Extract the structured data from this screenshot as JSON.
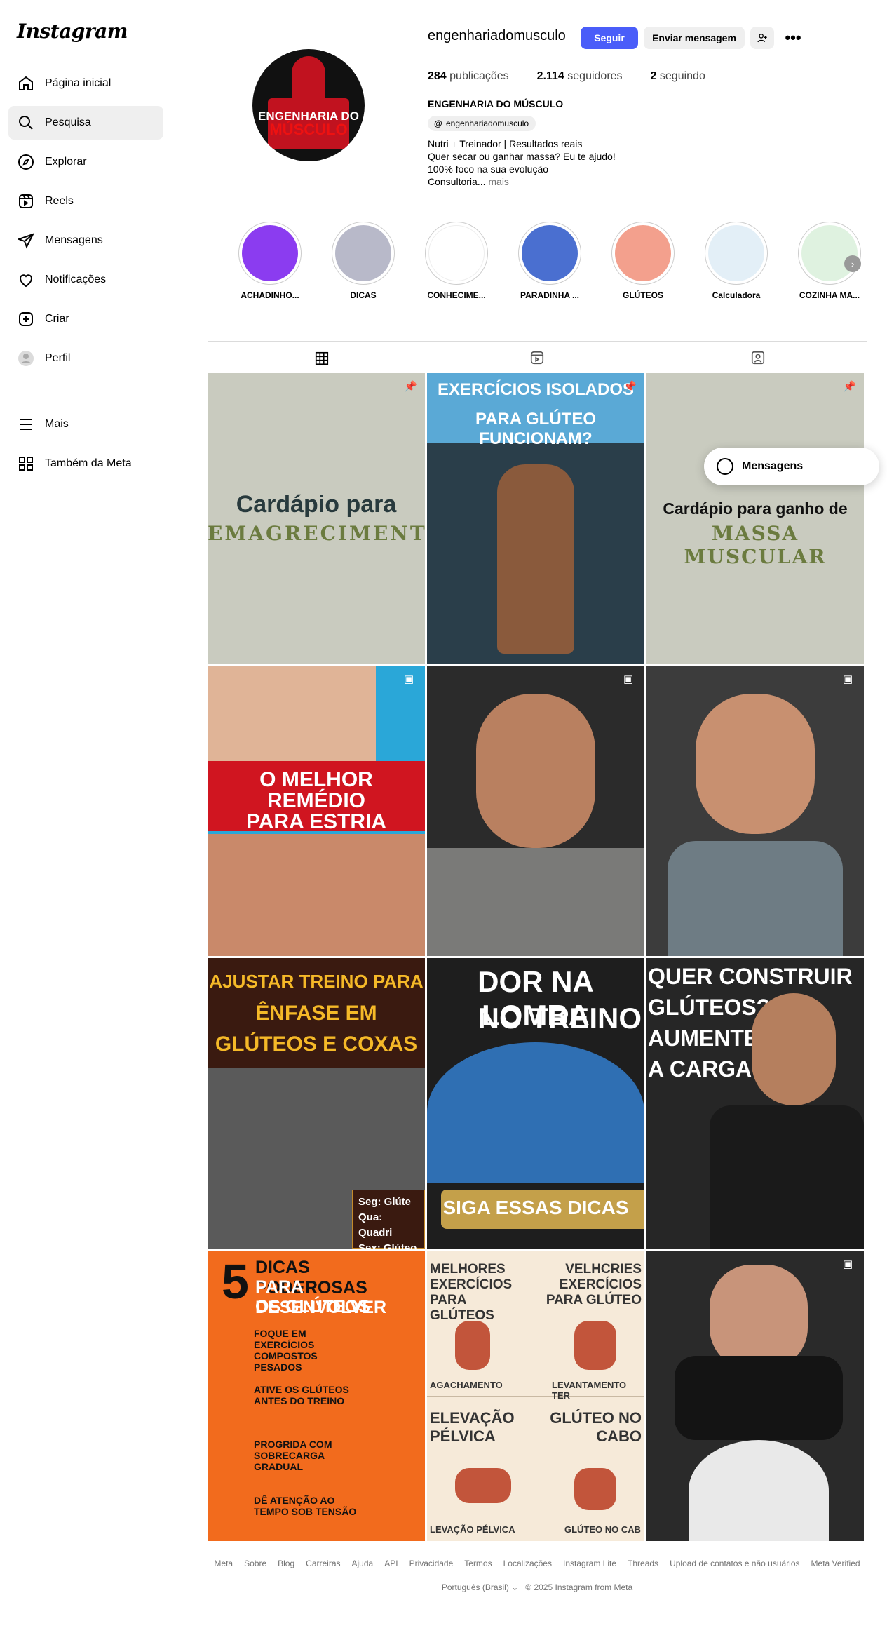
{
  "app": {
    "logo": "Instagram"
  },
  "sidebar": {
    "items": [
      {
        "label": "Página inicial",
        "icon": "home-icon"
      },
      {
        "label": "Pesquisa",
        "icon": "search-icon"
      },
      {
        "label": "Explorar",
        "icon": "compass-icon"
      },
      {
        "label": "Reels",
        "icon": "reels-icon"
      },
      {
        "label": "Mensagens",
        "icon": "send-icon"
      },
      {
        "label": "Notificações",
        "icon": "heart-icon"
      },
      {
        "label": "Criar",
        "icon": "plus-icon"
      },
      {
        "label": "Perfil",
        "icon": "avatar-icon"
      }
    ],
    "bottom": [
      {
        "label": "Mais",
        "icon": "menu-icon"
      },
      {
        "label": "Também da Meta",
        "icon": "meta-apps-icon"
      }
    ]
  },
  "profile": {
    "avatar_text_1": "ENGENHARIA DO",
    "avatar_text_2": "MÚSCULO",
    "username": "engenhariadomusculo",
    "follow_label": "Seguir",
    "message_label": "Enviar mensagem",
    "more_label": "•••",
    "posts_count": "284",
    "posts_label": "publicações",
    "followers_count": "2.114",
    "followers_label": "seguidores",
    "following_count": "2",
    "following_label": "seguindo",
    "full_name": "ENGENHARIA DO MÚSCULO",
    "threads_handle": "engenhariadomusculo",
    "bio_lines": [
      "Nutri + Treinador | Resultados reais",
      "Quer secar ou ganhar massa? Eu te ajudo!",
      "100% foco na sua evolução",
      "Consultoria..."
    ],
    "bio_more": "mais"
  },
  "highlights": [
    {
      "label": "ACHADINHO...",
      "color": "#8b3cf0"
    },
    {
      "label": "DICAS",
      "color": "#b8b9c9"
    },
    {
      "label": "CONHECIME...",
      "color": "#ffffff"
    },
    {
      "label": "PARADINHA ...",
      "color": "#4a6fd0"
    },
    {
      "label": "GLÚTEOS",
      "color": "#f3a08d"
    },
    {
      "label": "Calculadora",
      "color": "#e3eff7"
    },
    {
      "label": "COZINHA MA...",
      "color": "#dff2e0"
    }
  ],
  "tabs": [
    {
      "name": "tab-posts",
      "icon": "grid-icon"
    },
    {
      "name": "tab-reels",
      "icon": "reels-icon"
    },
    {
      "name": "tab-tagged",
      "icon": "tagged-icon"
    }
  ],
  "posts": [
    {
      "line1": "Cardápio para",
      "line2": "EMAGRECIMENTO",
      "badge": "pin-icon"
    },
    {
      "line1": "EXERCÍCIOS ISOLADOS",
      "line2": "PARA GLÚTEO FUNCIONAM?",
      "badge": "pin-icon"
    },
    {
      "line1": "Cardápio para ganho de",
      "line2": "MASSA MUSCULAR",
      "badge": "pin-icon"
    },
    {
      "line1": "O MELHOR",
      "line2": "REMÉDIO",
      "line3": "PARA ESTRIA",
      "badge": "reel-icon"
    },
    {
      "badge": "reel-icon"
    },
    {
      "badge": "reel-icon"
    },
    {
      "line1": "AJUSTAR TREINO PARA",
      "line2": "ÊNFASE EM",
      "line3": "GLÚTEOS E COXAS",
      "note1": "Seg: Glúte",
      "note2": "Qua: Quadri",
      "note3": "Sex: Glúteo"
    },
    {
      "line1": "DOR NA LOMBA",
      "line2": "NO TREINO",
      "line3": "SIGA ESSAS DICAS"
    },
    {
      "line1": "QUER CONSTRUIR",
      "line2": "GLÚTEOS?",
      "line3": "AUMENTE",
      "line4": "A CARGA!"
    },
    {
      "line1": "DICAS PODEROSAS",
      "line2": "PARA DESENVOLVER",
      "line3": "OS GLÚTEOS",
      "num": "5",
      "tips": [
        "FOQUE EM EXERCÍCIOS COMPOSTOS PESADOS",
        "ATIVE OS GLÚTEOS ANTES DO TREINO",
        "PROGRIDA COM SOBRECARGA GRADUAL",
        "DÊ ATENÇÃO AO TEMPO SOB TENSÃO"
      ]
    },
    {
      "q1": "MELHORES EXERCÍCIOS PARA GLÚTEOS",
      "q2": "VELHCRIES EXERCÍCIOS PARA GLÚTEO",
      "q3": "ELEVAÇÃO PÉLVICA",
      "q4": "GLÚTEO NO CABO",
      "c1": "AGACHAMENTO",
      "c2": "LEVANTAMENTO TER",
      "c3": "LEVAÇÃO PÉLVICA",
      "c4": "GLÚTEO NO CAB"
    },
    {
      "badge": "reel-icon"
    }
  ],
  "floating": {
    "messages_label": "Mensagens"
  },
  "footer": {
    "links": [
      "Meta",
      "Sobre",
      "Blog",
      "Carreiras",
      "Ajuda",
      "API",
      "Privacidade",
      "Termos",
      "Localizações",
      "Instagram Lite",
      "Threads",
      "Upload de contatos e não usuários",
      "Meta Verified"
    ],
    "language": "Português (Brasil)",
    "copyright": "© 2025 Instagram from Meta"
  }
}
